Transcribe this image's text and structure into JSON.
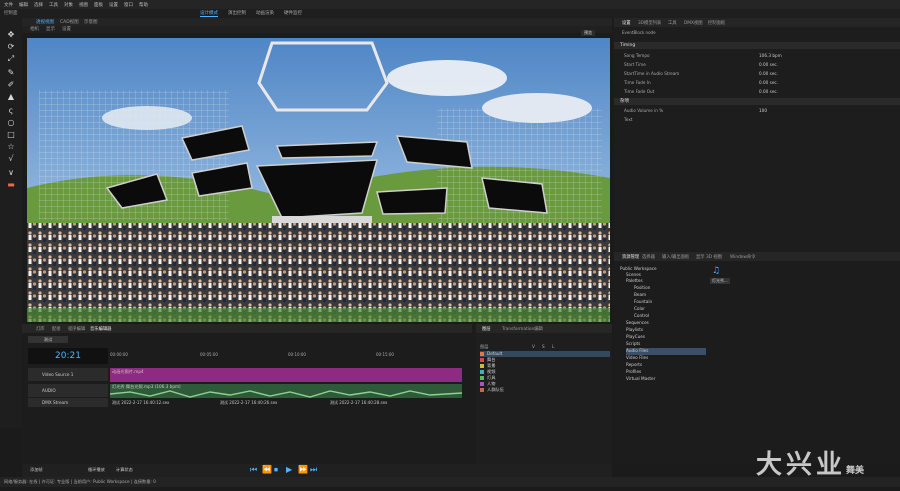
{
  "menu": [
    "文件",
    "编辑",
    "选择",
    "工具",
    "对象",
    "视图",
    "面板",
    "设置",
    "窗口",
    "帮助"
  ],
  "modes": [
    "设计模式",
    "演出控制",
    "动画渲染",
    "硬件监控"
  ],
  "left_label": "控制面",
  "viewport_tabs": [
    "透视视图",
    "CAD视图",
    "示意图"
  ],
  "viewport_sub": [
    "相机",
    "显示",
    "设置"
  ],
  "viewport_button": "预览",
  "right_tabs": [
    "设置",
    "3D模型列表",
    "工具",
    "DMX视图",
    "控制面板"
  ],
  "right_subtitle": "EventBlock node",
  "sections": {
    "timing": "Timing",
    "misc": "杂项"
  },
  "properties": [
    {
      "label": "Song Tempo",
      "value": "106.3 bpm"
    },
    {
      "label": "Start Time",
      "value": "0.00 sec."
    },
    {
      "label": "StartTime in Audio Stream",
      "value": "0.00 sec."
    },
    {
      "label": "Time Fade In",
      "value": "0.00 sec."
    },
    {
      "label": "Time Fade Out",
      "value": "0.00 sec."
    }
  ],
  "misc_props": [
    {
      "label": "Audio Volume in %",
      "value": "100"
    },
    {
      "label": "Text",
      "value": ""
    }
  ],
  "bottom_tabs": [
    "灯库",
    "配接",
    "程序编辑",
    "音乐编辑器"
  ],
  "bottom_left_btn": "测试",
  "timecode": "20:21",
  "ruler": [
    "00:00:00",
    "00:05:00",
    "00:10:00",
    "00:15:00"
  ],
  "tracks": [
    {
      "name": "Video Source 1",
      "clip": "动画光照片.mp4",
      "color": "#8e2a7f"
    },
    {
      "name": "AUDIO",
      "clip": "灯光秀 舞台光照.mp3 (106.3 bpm)",
      "color": "#2f5a3a"
    },
    {
      "name": "DMX Stream",
      "clip": "测试 2022-2-17 16:40:12.sex",
      "color": "#2d2d2d"
    }
  ],
  "dmx_clips": [
    "测试 2022-2-17 16:40:26.sex",
    "测试 2022-2-17 16:40:28.sex"
  ],
  "layer_tabs": [
    "图层",
    "Transformation编辑"
  ],
  "layer_header": [
    "图层",
    "V",
    "S",
    "L"
  ],
  "layers": [
    {
      "name": "Default",
      "color": "#e07b39"
    },
    {
      "name": "舞台",
      "color": "#d04b4b"
    },
    {
      "name": "背景",
      "color": "#c0c040"
    },
    {
      "name": "视频",
      "color": "#40b0c0"
    },
    {
      "name": "灯具",
      "color": "#50c050"
    },
    {
      "name": "人物",
      "color": "#b050c0"
    },
    {
      "name": "人群队伍",
      "color": "#d06060"
    }
  ],
  "resource_tabs": [
    "资源管理",
    "选择器",
    "输入/输出面板",
    "显示 3D 视图",
    "Window命令"
  ],
  "tree": [
    {
      "label": "Public Workspace",
      "level": 0
    },
    {
      "label": "Scenes",
      "level": 1
    },
    {
      "label": "Palettes",
      "level": 1
    },
    {
      "label": "Position",
      "level": 2
    },
    {
      "label": "Beam",
      "level": 2
    },
    {
      "label": "Fountain",
      "level": 2
    },
    {
      "label": "Color",
      "level": 2
    },
    {
      "label": "Control",
      "level": 2
    },
    {
      "label": "Sequences",
      "level": 1
    },
    {
      "label": "Playlists",
      "level": 1
    },
    {
      "label": "PlayCues",
      "level": 1
    },
    {
      "label": "Scripts",
      "level": 1
    },
    {
      "label": "Audio Files",
      "level": 1
    },
    {
      "label": "Video Files",
      "level": 1
    },
    {
      "label": "Reports",
      "level": 1
    },
    {
      "label": "Profiles",
      "level": 1
    },
    {
      "label": "Virtual Master",
      "level": 1
    }
  ],
  "resource_file": "灯光秀...",
  "transport": {
    "buttons": [
      "⏮",
      "⏪",
      "⏹",
      "▶",
      "⏩",
      "⏭"
    ],
    "left": [
      "添加帧",
      "循环播放",
      "计算状态"
    ]
  },
  "status": "网络/服务器: 在线  | 许可证: 专业版  | 当前用户: Public Workspace  | 连接数量: 0",
  "watermark": "大兴业",
  "watermark_sub": "舞美"
}
